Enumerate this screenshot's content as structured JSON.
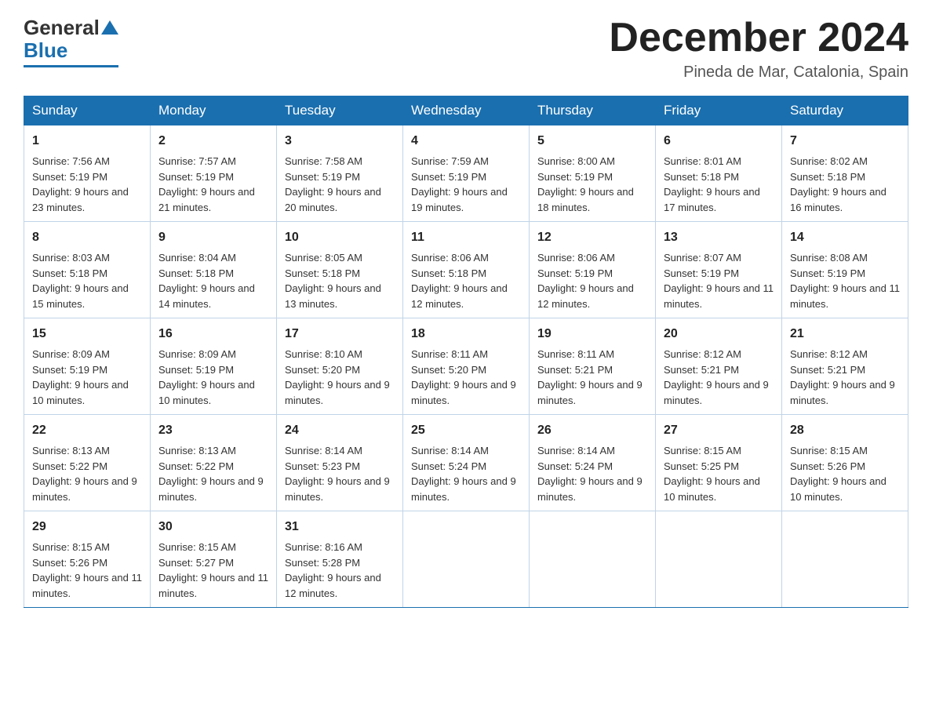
{
  "logo": {
    "text_general": "General",
    "text_blue": "Blue"
  },
  "header": {
    "month": "December 2024",
    "location": "Pineda de Mar, Catalonia, Spain"
  },
  "days_of_week": [
    "Sunday",
    "Monday",
    "Tuesday",
    "Wednesday",
    "Thursday",
    "Friday",
    "Saturday"
  ],
  "weeks": [
    [
      {
        "day": "1",
        "sunrise": "7:56 AM",
        "sunset": "5:19 PM",
        "daylight": "9 hours and 23 minutes."
      },
      {
        "day": "2",
        "sunrise": "7:57 AM",
        "sunset": "5:19 PM",
        "daylight": "9 hours and 21 minutes."
      },
      {
        "day": "3",
        "sunrise": "7:58 AM",
        "sunset": "5:19 PM",
        "daylight": "9 hours and 20 minutes."
      },
      {
        "day": "4",
        "sunrise": "7:59 AM",
        "sunset": "5:19 PM",
        "daylight": "9 hours and 19 minutes."
      },
      {
        "day": "5",
        "sunrise": "8:00 AM",
        "sunset": "5:19 PM",
        "daylight": "9 hours and 18 minutes."
      },
      {
        "day": "6",
        "sunrise": "8:01 AM",
        "sunset": "5:18 PM",
        "daylight": "9 hours and 17 minutes."
      },
      {
        "day": "7",
        "sunrise": "8:02 AM",
        "sunset": "5:18 PM",
        "daylight": "9 hours and 16 minutes."
      }
    ],
    [
      {
        "day": "8",
        "sunrise": "8:03 AM",
        "sunset": "5:18 PM",
        "daylight": "9 hours and 15 minutes."
      },
      {
        "day": "9",
        "sunrise": "8:04 AM",
        "sunset": "5:18 PM",
        "daylight": "9 hours and 14 minutes."
      },
      {
        "day": "10",
        "sunrise": "8:05 AM",
        "sunset": "5:18 PM",
        "daylight": "9 hours and 13 minutes."
      },
      {
        "day": "11",
        "sunrise": "8:06 AM",
        "sunset": "5:18 PM",
        "daylight": "9 hours and 12 minutes."
      },
      {
        "day": "12",
        "sunrise": "8:06 AM",
        "sunset": "5:19 PM",
        "daylight": "9 hours and 12 minutes."
      },
      {
        "day": "13",
        "sunrise": "8:07 AM",
        "sunset": "5:19 PM",
        "daylight": "9 hours and 11 minutes."
      },
      {
        "day": "14",
        "sunrise": "8:08 AM",
        "sunset": "5:19 PM",
        "daylight": "9 hours and 11 minutes."
      }
    ],
    [
      {
        "day": "15",
        "sunrise": "8:09 AM",
        "sunset": "5:19 PM",
        "daylight": "9 hours and 10 minutes."
      },
      {
        "day": "16",
        "sunrise": "8:09 AM",
        "sunset": "5:19 PM",
        "daylight": "9 hours and 10 minutes."
      },
      {
        "day": "17",
        "sunrise": "8:10 AM",
        "sunset": "5:20 PM",
        "daylight": "9 hours and 9 minutes."
      },
      {
        "day": "18",
        "sunrise": "8:11 AM",
        "sunset": "5:20 PM",
        "daylight": "9 hours and 9 minutes."
      },
      {
        "day": "19",
        "sunrise": "8:11 AM",
        "sunset": "5:21 PM",
        "daylight": "9 hours and 9 minutes."
      },
      {
        "day": "20",
        "sunrise": "8:12 AM",
        "sunset": "5:21 PM",
        "daylight": "9 hours and 9 minutes."
      },
      {
        "day": "21",
        "sunrise": "8:12 AM",
        "sunset": "5:21 PM",
        "daylight": "9 hours and 9 minutes."
      }
    ],
    [
      {
        "day": "22",
        "sunrise": "8:13 AM",
        "sunset": "5:22 PM",
        "daylight": "9 hours and 9 minutes."
      },
      {
        "day": "23",
        "sunrise": "8:13 AM",
        "sunset": "5:22 PM",
        "daylight": "9 hours and 9 minutes."
      },
      {
        "day": "24",
        "sunrise": "8:14 AM",
        "sunset": "5:23 PM",
        "daylight": "9 hours and 9 minutes."
      },
      {
        "day": "25",
        "sunrise": "8:14 AM",
        "sunset": "5:24 PM",
        "daylight": "9 hours and 9 minutes."
      },
      {
        "day": "26",
        "sunrise": "8:14 AM",
        "sunset": "5:24 PM",
        "daylight": "9 hours and 9 minutes."
      },
      {
        "day": "27",
        "sunrise": "8:15 AM",
        "sunset": "5:25 PM",
        "daylight": "9 hours and 10 minutes."
      },
      {
        "day": "28",
        "sunrise": "8:15 AM",
        "sunset": "5:26 PM",
        "daylight": "9 hours and 10 minutes."
      }
    ],
    [
      {
        "day": "29",
        "sunrise": "8:15 AM",
        "sunset": "5:26 PM",
        "daylight": "9 hours and 11 minutes."
      },
      {
        "day": "30",
        "sunrise": "8:15 AM",
        "sunset": "5:27 PM",
        "daylight": "9 hours and 11 minutes."
      },
      {
        "day": "31",
        "sunrise": "8:16 AM",
        "sunset": "5:28 PM",
        "daylight": "9 hours and 12 minutes."
      },
      null,
      null,
      null,
      null
    ]
  ]
}
